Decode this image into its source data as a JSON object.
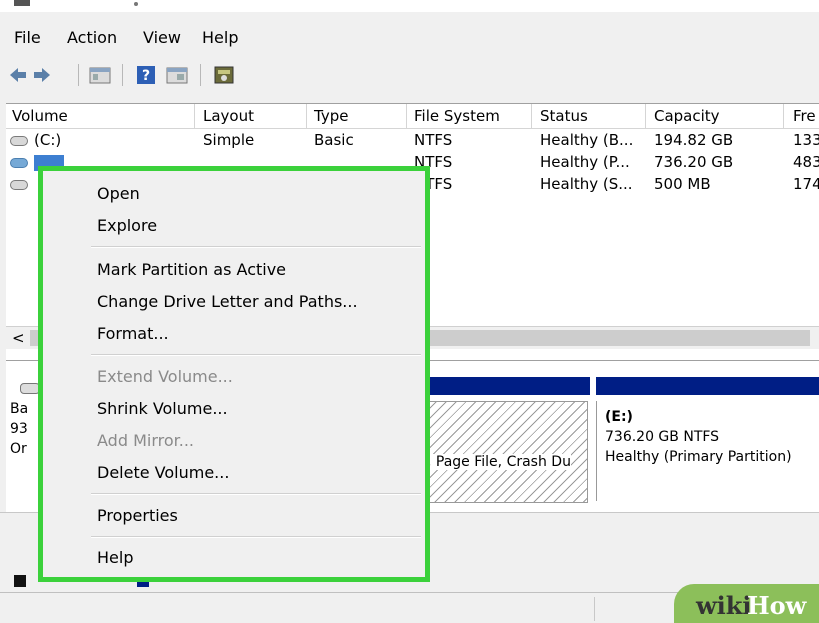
{
  "menubar": {
    "file": "File",
    "action": "Action",
    "view": "View",
    "help": "Help"
  },
  "toolbar": {
    "icons": [
      "back-arrow-icon",
      "forward-arrow-icon",
      "console-tree-icon",
      "help-icon",
      "properties-icon",
      "disk-icon"
    ]
  },
  "volume_list": {
    "columns": [
      "Volume",
      "Layout",
      "Type",
      "File System",
      "Status",
      "Capacity",
      "Fre"
    ],
    "rows": [
      {
        "volume": "(C:)",
        "layout": "Simple",
        "type": "Basic",
        "fs": "NTFS",
        "status": "Healthy (B...",
        "capacity": "194.82 GB",
        "free": "133"
      },
      {
        "volume": "",
        "layout": "",
        "type": "",
        "fs": "NTFS",
        "status": "Healthy (P...",
        "capacity": "736.20 GB",
        "free": "483"
      },
      {
        "volume": "",
        "layout": "",
        "type": "",
        "fs": "NTFS",
        "status": "Healthy (S...",
        "capacity": "500 MB",
        "free": "174"
      }
    ]
  },
  "scroll": {
    "left_arrow": "<"
  },
  "disk_panel": {
    "disk_label_prefix": "Ba",
    "disk_size_prefix": "93",
    "disk_status_prefix": "Or",
    "hatched_partition_text": ", Page File, Crash Du",
    "e_partition": {
      "name": "(E:)",
      "size": "736.20 GB NTFS",
      "status": "Healthy (Primary Partition)"
    }
  },
  "context_menu": {
    "open": "Open",
    "explore": "Explore",
    "mark_active": "Mark Partition as Active",
    "change_letter": "Change Drive Letter and Paths...",
    "format": "Format...",
    "extend": "Extend Volume...",
    "shrink": "Shrink Volume...",
    "add_mirror": "Add Mirror...",
    "delete": "Delete Volume...",
    "properties": "Properties",
    "help": "Help"
  },
  "watermark": {
    "wiki": "wiki",
    "how": "How"
  },
  "colors": {
    "highlight_border": "#3bd13b",
    "disk_bar": "#001e85",
    "wikihow_green": "#8cbf5a"
  }
}
